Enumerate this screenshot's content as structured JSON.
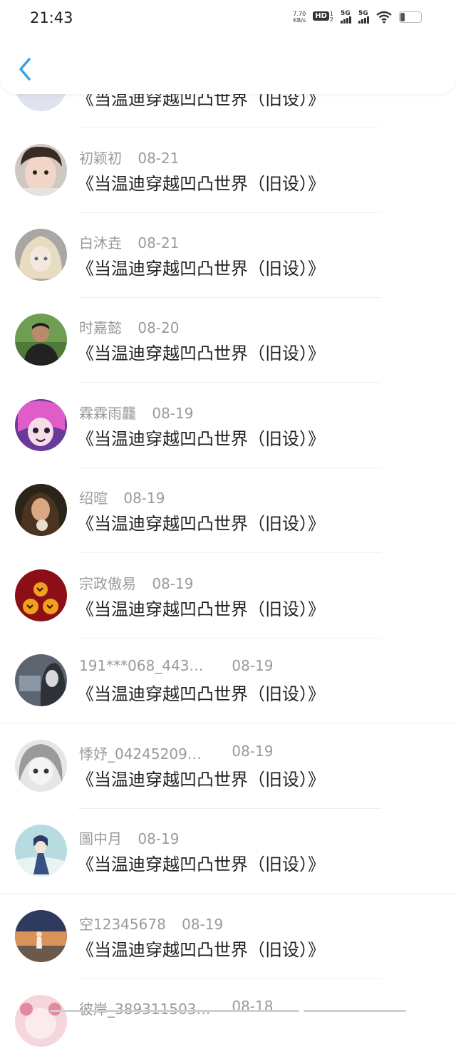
{
  "status_bar": {
    "time": "21:43",
    "net_speed_value": "7.70",
    "net_speed_unit": "KB/s",
    "hd_label": "HD",
    "hd_sub_top": "1",
    "hd_sub_bottom": "2",
    "signal1_label": "5G",
    "signal2_label": "5G"
  },
  "header": {
    "back_icon": "chevron-left-icon",
    "accent": "#3aa0e6"
  },
  "rows": [
    {
      "name": "",
      "date": "",
      "title": "《当温迪穿越凹凸世界（旧设）》"
    },
    {
      "name": "初颖初",
      "date": "08-21",
      "title": "《当温迪穿越凹凸世界（旧设）》"
    },
    {
      "name": "白沐垚",
      "date": "08-21",
      "title": "《当温迪穿越凹凸世界（旧设）》"
    },
    {
      "name": "时嘉懿",
      "date": "08-20",
      "title": "《当温迪穿越凹凸世界（旧设）》"
    },
    {
      "name": "霖霖雨龘",
      "date": "08-19",
      "title": "《当温迪穿越凹凸世界（旧设）》"
    },
    {
      "name": "绍暄",
      "date": "08-19",
      "title": "《当温迪穿越凹凸世界（旧设）》"
    },
    {
      "name": "宗政傲易",
      "date": "08-19",
      "title": "《当温迪穿越凹凸世界（旧设）》"
    },
    {
      "name": "191***068_443…",
      "date": "08-19",
      "title": "《当温迪穿越凹凸世界（旧设）》"
    },
    {
      "name": "悸妤_04245209…",
      "date": "08-19",
      "title": "《当温迪穿越凹凸世界（旧设）》"
    },
    {
      "name": "圖中月",
      "date": "08-19",
      "title": "《当温迪穿越凹凸世界（旧设）》"
    },
    {
      "name": "空12345678",
      "date": "08-19",
      "title": "《当温迪穿越凹凸世界（旧设）》"
    },
    {
      "name": "彼岸_389311503…",
      "date": "08-18",
      "title": ""
    }
  ]
}
